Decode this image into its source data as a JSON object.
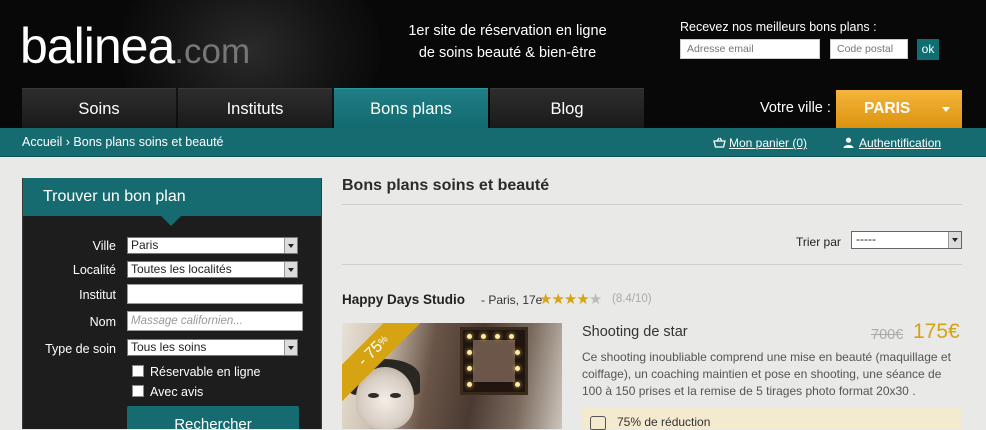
{
  "header": {
    "logo": {
      "main": "balinea",
      "suffix": ".com"
    },
    "tagline": [
      "1er site de réservation en ligne",
      "de soins beauté & bien-être"
    ],
    "newsletter": {
      "label": "Recevez nos meilleurs bons plans :",
      "email_placeholder": "Adresse email",
      "postal_placeholder": "Code postal",
      "submit_label": "ok"
    },
    "nav": [
      {
        "label": "Soins",
        "active": false
      },
      {
        "label": "Instituts",
        "active": false
      },
      {
        "label": "Bons plans",
        "active": true
      },
      {
        "label": "Blog",
        "active": false
      }
    ],
    "city": {
      "label": "Votre ville :",
      "value": "PARIS"
    }
  },
  "breadcrumb": {
    "text": "Accueil › Bons plans soins et beauté",
    "cart": "Mon panier (0)",
    "auth": "Authentification"
  },
  "search_panel": {
    "title": "Trouver un bon plan",
    "fields": {
      "ville": {
        "label": "Ville",
        "value": "Paris"
      },
      "localite": {
        "label": "Localité",
        "value": "Toutes les localités"
      },
      "institut": {
        "label": "Institut",
        "value": ""
      },
      "nom": {
        "label": "Nom",
        "placeholder": "Massage californien..."
      },
      "type_de_soin": {
        "label": "Type de soin",
        "value": "Tous les soins"
      }
    },
    "checkboxes": [
      {
        "label": "Réservable en ligne",
        "checked": false
      },
      {
        "label": "Avec avis",
        "checked": false
      }
    ],
    "button_label": "Rechercher"
  },
  "main": {
    "title": "Bons plans soins et beauté",
    "sort": {
      "label": "Trier par",
      "value": "-----"
    },
    "deal": {
      "name": "Happy Days Studio",
      "location": "- Paris, 17e",
      "rating_stars": 4,
      "rating_max": 5,
      "rating_text": "(8.4/10)",
      "discount": "- 75",
      "discount_unit": "%",
      "title": "Shooting de star",
      "old_price": "700€",
      "new_price": "175€",
      "description": "Ce shooting inoubliable comprend une mise en beauté (maquillage et coiffage), un coaching maintien et pose en shooting, une séance de 100 à 150 prises et la remise de 5 tirages photo format 20x30 .",
      "reduction": "75% de réduction"
    }
  },
  "colors": {
    "teal": "#166b71",
    "gold": "#d6a313",
    "orange": "#f0a92a",
    "dark": "#080808"
  }
}
